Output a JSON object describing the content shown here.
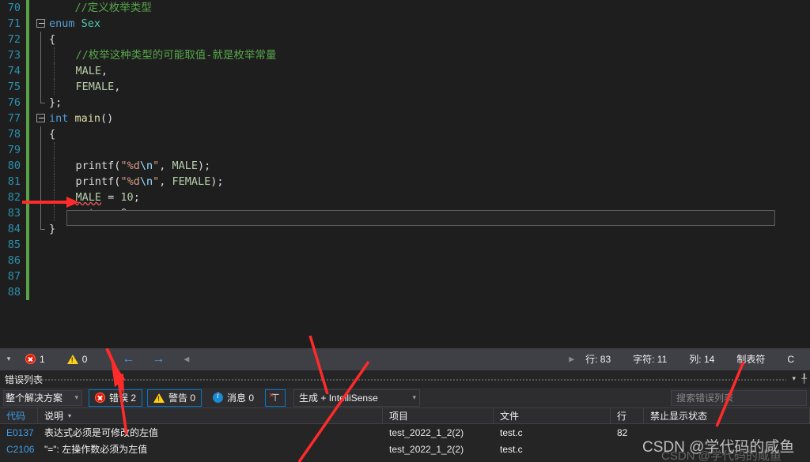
{
  "editor": {
    "first_line": 70,
    "last_line": 88,
    "lines": [
      {
        "n": 70,
        "tokens": [
          {
            "t": "    ",
            "c": "t-pln"
          },
          {
            "t": "//定义枚举类型",
            "c": "t-com"
          }
        ],
        "fold": "none",
        "indent": 0
      },
      {
        "n": 71,
        "tokens": [
          {
            "t": "enum",
            "c": "t-kw"
          },
          {
            "t": " ",
            "c": "t-pln"
          },
          {
            "t": "Sex",
            "c": "t-type"
          }
        ],
        "fold": "box",
        "indent": 0
      },
      {
        "n": 72,
        "tokens": [
          {
            "t": "{",
            "c": "t-pun"
          }
        ],
        "fold": "line",
        "indent": 0
      },
      {
        "n": 73,
        "tokens": [
          {
            "t": "    ",
            "c": "t-pln"
          },
          {
            "t": "//枚举这种类型的可能取值-就是枚举常量",
            "c": "t-com"
          }
        ],
        "fold": "line",
        "indent": 1
      },
      {
        "n": 74,
        "tokens": [
          {
            "t": "    ",
            "c": "t-pln"
          },
          {
            "t": "MALE",
            "c": "t-const"
          },
          {
            "t": ",",
            "c": "t-pun"
          }
        ],
        "fold": "line",
        "indent": 1
      },
      {
        "n": 75,
        "tokens": [
          {
            "t": "    ",
            "c": "t-pln"
          },
          {
            "t": "FEMALE",
            "c": "t-const"
          },
          {
            "t": ",",
            "c": "t-pun"
          }
        ],
        "fold": "line",
        "indent": 1
      },
      {
        "n": 76,
        "tokens": [
          {
            "t": "};",
            "c": "t-pun"
          }
        ],
        "fold": "end",
        "indent": 0
      },
      {
        "n": 77,
        "tokens": [
          {
            "t": "int",
            "c": "t-kw"
          },
          {
            "t": " ",
            "c": "t-pln"
          },
          {
            "t": "main",
            "c": "t-fn"
          },
          {
            "t": "()",
            "c": "t-pun"
          }
        ],
        "fold": "box",
        "indent": 0
      },
      {
        "n": 78,
        "tokens": [
          {
            "t": "{",
            "c": "t-pun"
          }
        ],
        "fold": "line",
        "indent": 0
      },
      {
        "n": 79,
        "tokens": [],
        "fold": "line",
        "indent": 1
      },
      {
        "n": 80,
        "tokens": [
          {
            "t": "    ",
            "c": "t-pln"
          },
          {
            "t": "printf",
            "c": "t-pln"
          },
          {
            "t": "(",
            "c": "t-pun"
          },
          {
            "t": "\"%d",
            "c": "t-str"
          },
          {
            "t": "\\n",
            "c": "t-esc"
          },
          {
            "t": "\"",
            "c": "t-str"
          },
          {
            "t": ", ",
            "c": "t-pun"
          },
          {
            "t": "MALE",
            "c": "t-const"
          },
          {
            "t": ");",
            "c": "t-pun"
          }
        ],
        "fold": "line",
        "indent": 1
      },
      {
        "n": 81,
        "tokens": [
          {
            "t": "    ",
            "c": "t-pln"
          },
          {
            "t": "printf",
            "c": "t-pln"
          },
          {
            "t": "(",
            "c": "t-pun"
          },
          {
            "t": "\"%d",
            "c": "t-str"
          },
          {
            "t": "\\n",
            "c": "t-esc"
          },
          {
            "t": "\"",
            "c": "t-str"
          },
          {
            "t": ", ",
            "c": "t-pun"
          },
          {
            "t": "FEMALE",
            "c": "t-const"
          },
          {
            "t": ");",
            "c": "t-pun"
          }
        ],
        "fold": "line",
        "indent": 1
      },
      {
        "n": 82,
        "tokens": [
          {
            "t": "    ",
            "c": "t-pln"
          },
          {
            "t": "MALE",
            "c": "t-const squiggle"
          },
          {
            "t": " = ",
            "c": "t-pun"
          },
          {
            "t": "10",
            "c": "t-num"
          },
          {
            "t": ";",
            "c": "t-pun"
          }
        ],
        "fold": "line",
        "indent": 1
      },
      {
        "n": 83,
        "tokens": [
          {
            "t": "    ",
            "c": "t-pln"
          },
          {
            "t": "return",
            "c": "t-ctl"
          },
          {
            "t": " ",
            "c": "t-pln"
          },
          {
            "t": "0",
            "c": "t-num"
          },
          {
            "t": ";",
            "c": "t-pun"
          }
        ],
        "fold": "line",
        "indent": 1
      },
      {
        "n": 84,
        "tokens": [
          {
            "t": "}",
            "c": "t-pun"
          }
        ],
        "fold": "end",
        "indent": 0
      },
      {
        "n": 85,
        "tokens": [],
        "fold": "none",
        "indent": 0
      },
      {
        "n": 86,
        "tokens": [],
        "fold": "none",
        "indent": 0
      },
      {
        "n": 87,
        "tokens": [],
        "fold": "none",
        "indent": 0
      },
      {
        "n": 88,
        "tokens": [],
        "fold": "none",
        "indent": 0
      }
    ]
  },
  "statusbar": {
    "error_count": "1",
    "warning_count": "0",
    "prev_label": "←",
    "next_label": "→",
    "line_label": "行: 83",
    "char_label": "字符: 11",
    "col_label": "列: 14",
    "tab_label": "制表符",
    "encoding_label": "C"
  },
  "error_panel": {
    "title": "错误列表",
    "toolbar": {
      "scope_value": "整个解决方案",
      "errors_label": "错误 2",
      "warnings_label": "警告 0",
      "messages_label": "消息 0",
      "filter_icon": "clear-filter-icon",
      "build_filter_value": "生成 + IntelliSense",
      "search_placeholder": "搜索错误列表"
    },
    "columns": [
      {
        "key": "code",
        "label": "代码"
      },
      {
        "key": "description",
        "label": "说明"
      },
      {
        "key": "project",
        "label": "项目"
      },
      {
        "key": "file",
        "label": "文件"
      },
      {
        "key": "line",
        "label": "行"
      },
      {
        "key": "suppression",
        "label": "禁止显示状态"
      }
    ],
    "sorted_column": "说明",
    "rows": [
      {
        "code": "E0137",
        "description": "表达式必须是可修改的左值",
        "project": "test_2022_1_2(2)",
        "file": "test.c",
        "line": "82",
        "suppression": ""
      },
      {
        "code": "C2106",
        "description": "\"=\": 左操作数必须为左值",
        "project": "test_2022_1_2(2)",
        "file": "test.c",
        "line": "",
        "suppression": ""
      }
    ]
  },
  "watermark": {
    "text": "CSDN @学代码的咸鱼",
    "text2": "CSDN @学代码的咸鱼"
  },
  "colors": {
    "accent": "#007acc",
    "error": "#e51400",
    "warning": "#ffd016",
    "info": "#1a8ad4",
    "link": "#3f9ee8",
    "annotation": "#ff2a2a",
    "savebar": "#58a146"
  }
}
